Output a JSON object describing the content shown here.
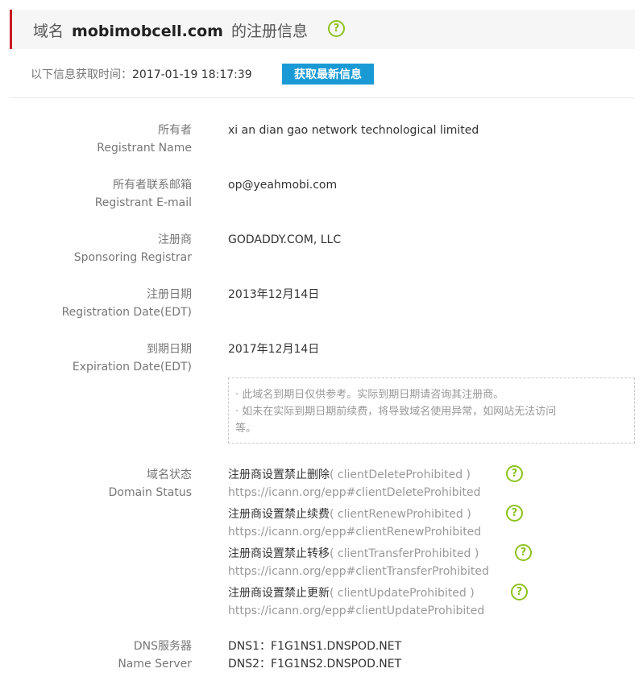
{
  "header": {
    "prefix": "域名",
    "domain": "mobimobcell.com",
    "suffix": "的注册信息",
    "help_icon": "question-circle-icon"
  },
  "fetch": {
    "label": "以下信息获取时间：",
    "time": "2017-01-19 18:17:39",
    "button": "获取最新信息"
  },
  "fields": {
    "registrant_name": {
      "cn": "所有者",
      "en": "Registrant Name",
      "value": "xi an dian gao network technological limited"
    },
    "registrant_email": {
      "cn": "所有者联系邮箱",
      "en": "Registrant E-mail",
      "value": "op@yeahmobi.com"
    },
    "registrar": {
      "cn": "注册商",
      "en": "Sponsoring Registrar",
      "value": "GODADDY.COM, LLC"
    },
    "registration_date": {
      "cn": "注册日期",
      "en": "Registration Date(EDT)",
      "value": "2013年12月14日"
    },
    "expiration_date": {
      "cn": "到期日期",
      "en": "Expiration Date(EDT)",
      "value": "2017年12月14日"
    }
  },
  "expiration_note": {
    "line1": "· 此域名到期日仅供参考。实际到期日期请咨询其注册商。",
    "line2": "· 如未在实际到期日期前续费，将导致域名使用异常，如网站无法访问",
    "line3": "等。"
  },
  "domain_status": {
    "cn": "域名状态",
    "en": "Domain Status",
    "items": [
      {
        "cn": "注册商设置禁止删除",
        "en": "( clientDeleteProhibited )",
        "url": "https://icann.org/epp#clientDeleteProhibited"
      },
      {
        "cn": "注册商设置禁止续费",
        "en": "( clientRenewProhibited )",
        "url": "https://icann.org/epp#clientRenewProhibited"
      },
      {
        "cn": "注册商设置禁止转移",
        "en": "( clientTransferProhibited )",
        "url": "https://icann.org/epp#clientTransferProhibited"
      },
      {
        "cn": "注册商设置禁止更新",
        "en": "( clientUpdateProhibited )",
        "url": "https://icann.org/epp#clientUpdateProhibited"
      }
    ]
  },
  "dns": {
    "cn": "DNS服务器",
    "en": "Name Server",
    "servers": [
      "DNS1：F1G1NS1.DNSPOD.NET",
      "DNS2：F1G1NS2.DNSPOD.NET"
    ]
  },
  "colors": {
    "accent_red": "#c91c22",
    "button_blue": "#1a9ad5",
    "help_green": "#8dc21f"
  }
}
